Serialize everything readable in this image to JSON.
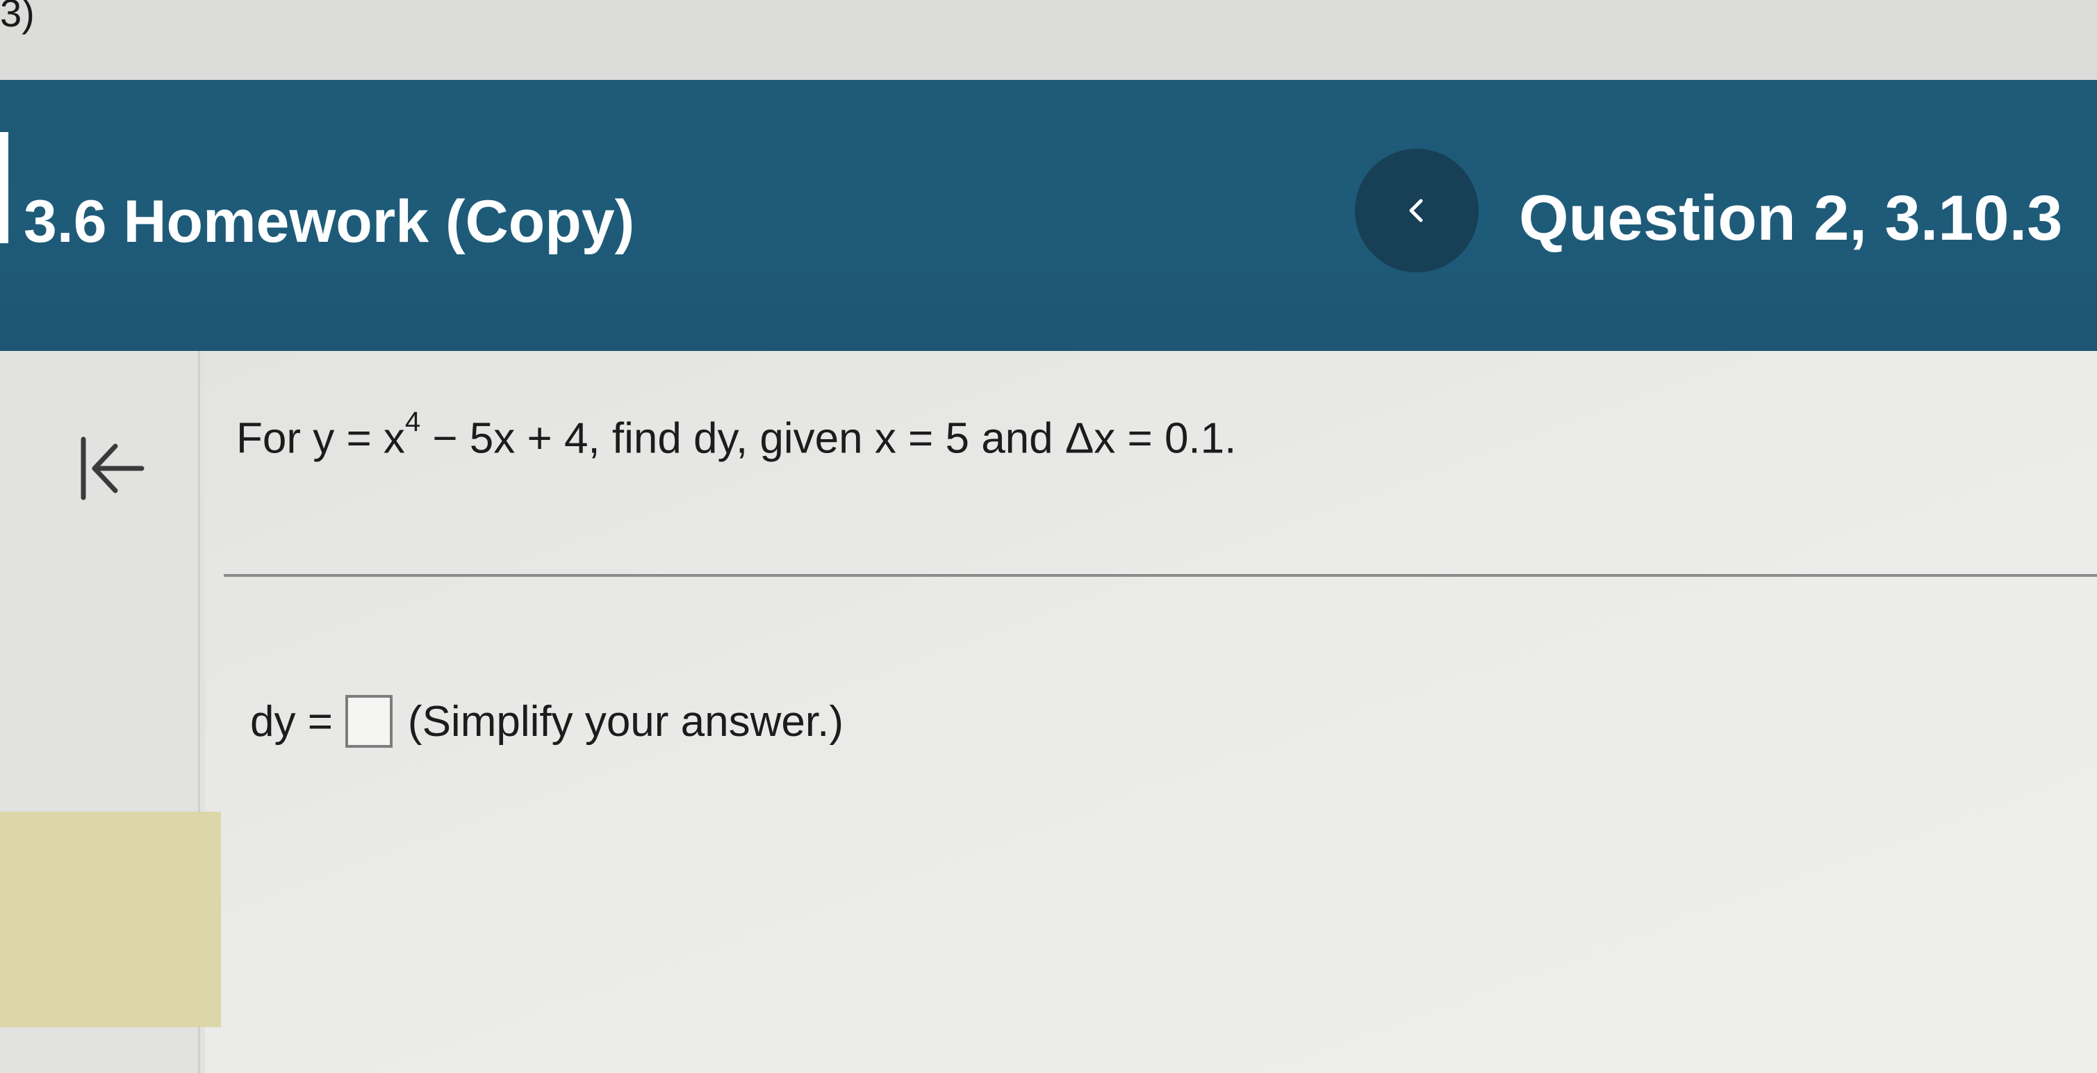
{
  "top_fragment": "3)",
  "header": {
    "course_title": "3.6 Homework (Copy)",
    "question_label": "Question 2, 3.10.3"
  },
  "icons": {
    "prev": "chevron-left-icon",
    "collapse": "collapse-left-icon"
  },
  "question": {
    "prefix": "For y = x",
    "exponent": "4",
    "suffix": " − 5x + 4, find dy, given x = 5 and Δx = 0.1."
  },
  "answer": {
    "label": "dy =",
    "value": "",
    "instruction": "(Simplify your answer.)"
  },
  "colors": {
    "header_bg": "#1e5b79",
    "prev_button_bg": "#173f56",
    "yellow_block": "#ddd6a8"
  }
}
